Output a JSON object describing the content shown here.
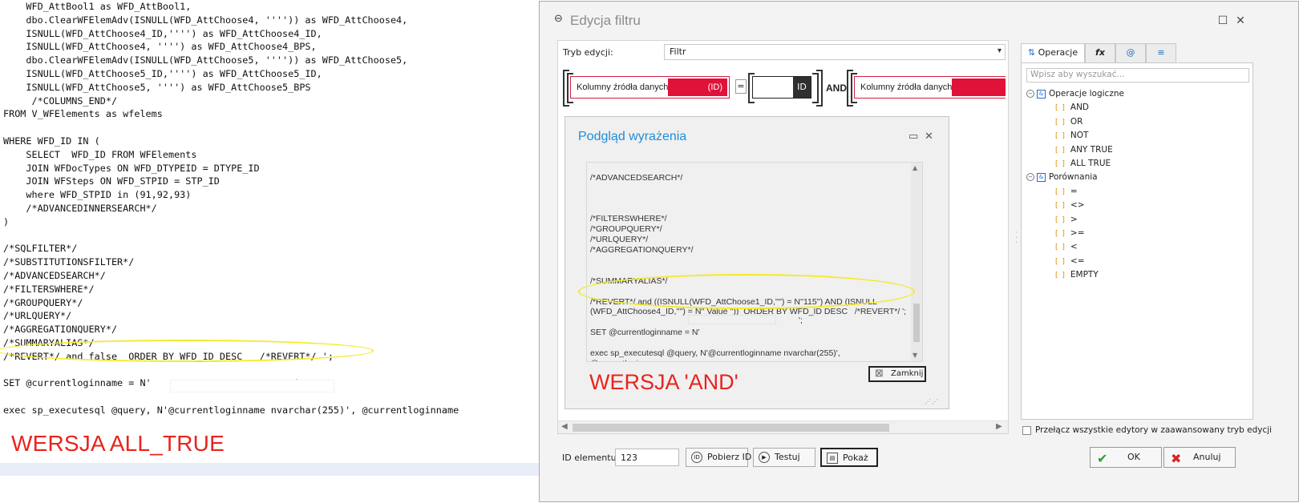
{
  "sql_editor": {
    "lines": [
      "    WFD_AttBool1 as WFD_AttBool1,",
      "    dbo.ClearWFElemAdv(ISNULL(WFD_AttChoose4, '''')) as WFD_AttChoose4,",
      "    ISNULL(WFD_AttChoose4_ID,'''') as WFD_AttChoose4_ID,",
      "    ISNULL(WFD_AttChoose4, '''') as WFD_AttChoose4_BPS,",
      "    dbo.ClearWFElemAdv(ISNULL(WFD_AttChoose5, '''')) as WFD_AttChoose5,",
      "    ISNULL(WFD_AttChoose5_ID,'''') as WFD_AttChoose5_ID,",
      "    ISNULL(WFD_AttChoose5, '''') as WFD_AttChoose5_BPS",
      "     /*COLUMNS_END*/",
      "FROM V_WFElements as wfelems",
      "",
      "WHERE WFD_ID IN (",
      "    SELECT  WFD_ID FROM WFElements",
      "    JOIN WFDocTypes ON WFD_DTYPEID = DTYPE_ID",
      "    JOIN WFSteps ON WFD_STPID = STP_ID",
      "    where WFD_STPID in (91,92,93)",
      "    /*ADVANCEDINNERSEARCH*/",
      ")",
      "",
      "/*SQLFILTER*/",
      "/*SUBSTITUTIONSFILTER*/",
      "/*ADVANCEDSEARCH*/",
      "/*FILTERSWHERE*/",
      "/*GROUPQUERY*/",
      "/*URLQUERY*/",
      "/*AGGREGATIONQUERY*/",
      "/*SUMMARYALIAS*/",
      "/*REVERT*/ and false  ORDER BY WFD_ID DESC   /*REVERT*/ ';",
      "",
      "SET @currentloginname = N'                         ';",
      "",
      "exec sp_executesql @query, N'@currentloginname nvarchar(255)', @currentloginname"
    ],
    "banner": "WERSJA ALL_TRUE"
  },
  "dialog": {
    "title": "Edycja filtru",
    "title_icon": "link-icon",
    "mode_label": "Tryb edycji:",
    "mode_value": "Filtr",
    "filter": {
      "col1_label": "Kolumny źródła danych",
      "col1_suffix": "(ID)",
      "op1": "=",
      "val1_suffix": "ID",
      "and_label": "AND",
      "col2_label": "Kolumny źródła danych"
    },
    "preview": {
      "title": "Podgląd wyrażenia",
      "lines": [
        "",
        "/*ADVANCEDSEARCH*/",
        "",
        "",
        "",
        "/*FILTERSWHERE*/",
        "/*GROUPQUERY*/",
        "/*URLQUERY*/",
        "/*AGGREGATIONQUERY*/",
        "",
        "",
        "/*SUMMARYALIAS*/",
        "",
        "/*REVERT*/ and ((ISNULL(WFD_AttChoose1_ID,'''') = N''115'') AND (ISNULL",
        "(WFD_AttChoose4_ID,'''') = N'' Value ''))  ORDER BY WFD_ID DESC   /*REVERT*/ ';",
        "",
        "SET @currentloginname = N'",
        "",
        "exec sp_executesql @query, N'@currentloginname nvarchar(255)',",
        "@currentloginname"
      ],
      "set_suffix": "';",
      "close_label": "Zamknij",
      "banner": "WERSJA 'AND'"
    },
    "tabs": [
      {
        "label": "Operacje",
        "icon": "operations-icon"
      },
      {
        "label": "fx",
        "icon": "function-icon"
      },
      {
        "label": "@",
        "icon": "variables-icon"
      },
      {
        "label": "≡",
        "icon": "list-icon"
      }
    ],
    "search_placeholder": "Wpisz aby wyszukać...",
    "tree": {
      "group1": "Operacje logiczne",
      "group1_items": [
        "AND",
        "OR",
        "NOT",
        "ANY TRUE",
        "ALL TRUE"
      ],
      "group2": "Porównania",
      "group2_items": [
        "=",
        "<>",
        ">",
        ">=",
        "<",
        "<=",
        "EMPTY"
      ]
    },
    "advanced_toggle": "Przełącz wszystkie edytory w zaawansowany tryb edycji",
    "id_label": "ID elementu:",
    "id_value": "123",
    "buttons": {
      "fetch_id": "Pobierz ID",
      "test": "Testuj",
      "show": "Pokaż",
      "ok": "OK",
      "cancel": "Anuluj"
    }
  }
}
